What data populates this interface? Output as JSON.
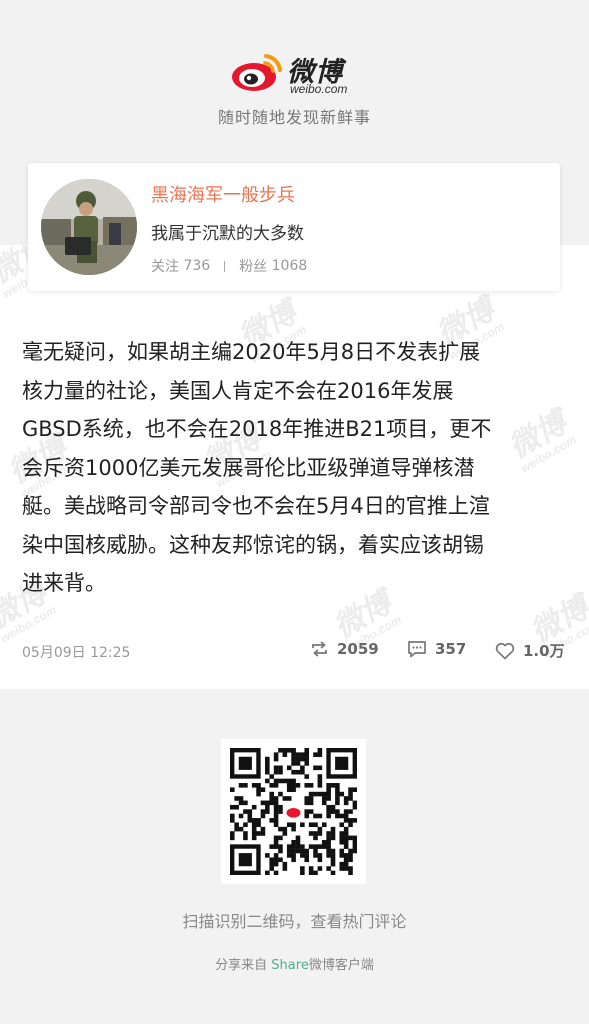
{
  "brand": {
    "wordmark": "微博",
    "domain": "weibo.com",
    "slogan": "随时随地发现新鲜事",
    "accent_color": "#e6162d",
    "watermark_text": "微博",
    "watermark_domain": "weibo.com"
  },
  "profile": {
    "username": "黑海海军一般步兵",
    "bio": "我属于沉默的大多数",
    "following_label": "关注",
    "following_count": "736",
    "followers_label": "粉丝",
    "followers_count": "1068",
    "name_color": "#eb7350"
  },
  "post": {
    "text": "毫无疑问，如果胡主编2020年5月8日不发表扩展\n核力量的社论，美国人肯定不会在2016年发展\nGBSD系统，也不会在2018年推进B21项目，更不\n会斥资1000亿美元发展哥伦比亚级弹道导弹核潜\n艇。美战略司令部司令也不会在5月4日的官推上渲\n染中国核威胁。这种友邦惊诧的锅，着实应该胡锡\n进来背。",
    "timestamp": "05月09日 12:25",
    "reposts": "2059",
    "comments": "357",
    "likes": "1.0万",
    "icons": [
      "repost-icon",
      "comment-icon",
      "like-icon"
    ]
  },
  "footer": {
    "qr_caption": "扫描识别二维码，查看热门评论",
    "share_prefix": "分享来自 ",
    "share_accent": "Share",
    "share_suffix": "微博客户端",
    "share_accent_color": "#4cae8f"
  }
}
